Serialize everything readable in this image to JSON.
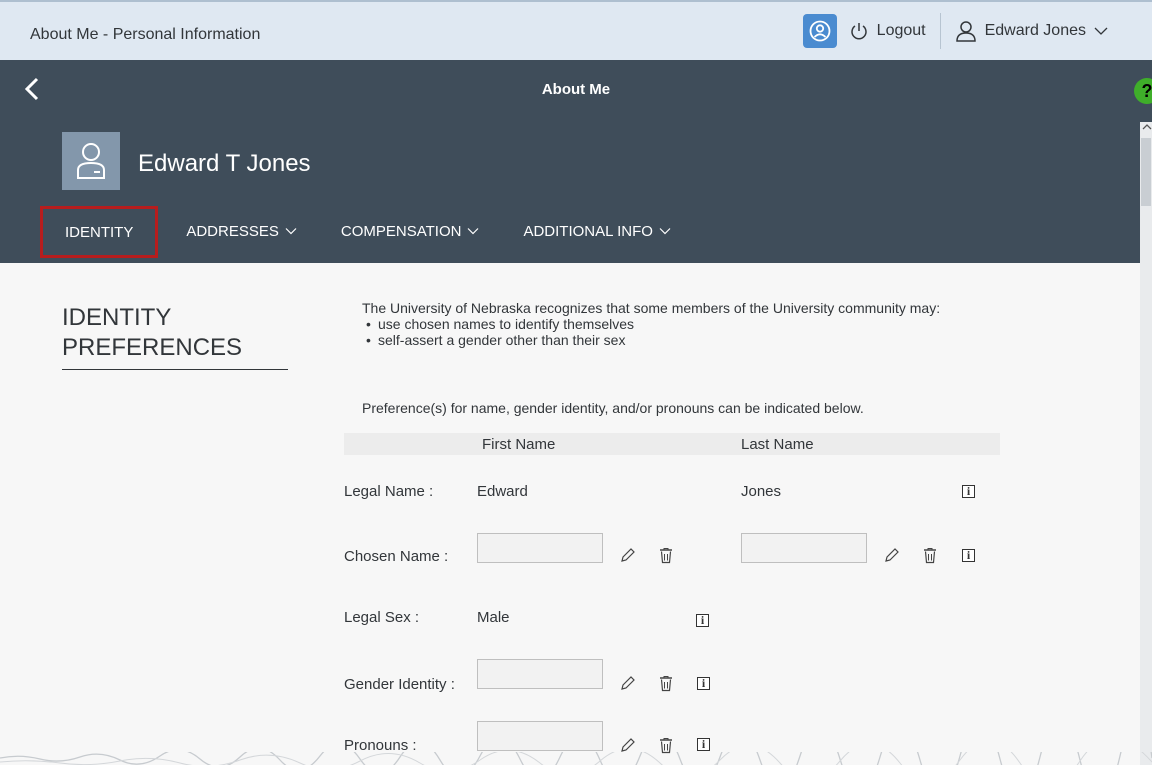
{
  "shell": {
    "title": "About Me - Personal Information",
    "logout_label": "Logout",
    "user_name": "Edward Jones"
  },
  "nav": {
    "title": "About Me",
    "help_glyph": "?"
  },
  "header": {
    "person_name": "Edward T Jones",
    "tabs": [
      {
        "label": "IDENTITY",
        "active": true
      },
      {
        "label": "ADDRESSES"
      },
      {
        "label": "COMPENSATION"
      },
      {
        "label": "ADDITIONAL INFO"
      }
    ]
  },
  "section": {
    "title_line1": "IDENTITY",
    "title_line2": "PREFERENCES",
    "intro": "The University of Nebraska recognizes that some members of the University community may:",
    "bullets": [
      "use chosen names to identify themselves",
      "self-assert a gender other than their sex"
    ],
    "pref_line": "Preference(s) for name, gender identity, and/or pronouns can be indicated below."
  },
  "table": {
    "col_first": "First Name",
    "col_last": "Last Name",
    "legal_name_label": "Legal Name :",
    "legal_first": "Edward",
    "legal_last": "Jones",
    "chosen_name_label": "Chosen Name :",
    "chosen_first": "",
    "chosen_last": "",
    "legal_sex_label": "Legal Sex :",
    "legal_sex": "Male",
    "gender_label": "Gender Identity :",
    "gender_value": "",
    "pronouns_label": "Pronouns :",
    "pronouns_value": ""
  },
  "icons": {
    "assist": "person-circle-icon",
    "logout": "power-icon",
    "user": "person-icon",
    "edit": "pencil-icon",
    "delete": "trash-icon",
    "info": "info-icon",
    "info_glyph": "i"
  },
  "colors": {
    "shell_bg": "#dfe8f2",
    "nav_bg": "#3f4d5a",
    "accent": "#4a8bd0",
    "active_tab_border": "#b71d1d",
    "help": "#3fae2a"
  }
}
